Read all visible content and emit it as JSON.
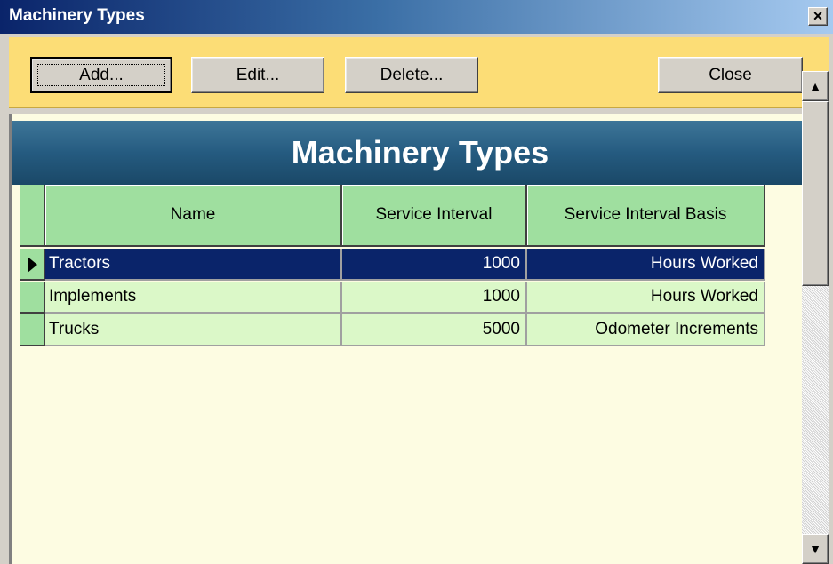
{
  "window": {
    "title": "Machinery Types",
    "close_glyph": "×"
  },
  "toolbar": {
    "add_label": "Add...",
    "edit_label": "Edit...",
    "delete_label": "Delete...",
    "close_label": "Close"
  },
  "form": {
    "heading": "Machinery Types"
  },
  "grid": {
    "columns": [
      "Name",
      "Service Interval",
      "Service Interval Basis"
    ],
    "rows": [
      {
        "name": "Tractors",
        "interval": "1000",
        "basis": "Hours Worked"
      },
      {
        "name": "Implements",
        "interval": "1000",
        "basis": "Hours Worked"
      },
      {
        "name": "Trucks",
        "interval": "5000",
        "basis": "Odometer Increments"
      }
    ],
    "selected_row": 0
  },
  "scrollbar": {
    "up_glyph": "▲",
    "down_glyph": "▼"
  },
  "colors": {
    "toolbar_bg": "#fcdd76",
    "banner_bg": "#255b80",
    "header_bg": "#9fdf9f",
    "row_bg": "#dbf8c8",
    "selected_bg": "#0a246a",
    "form_bg": "#fdfce2"
  }
}
